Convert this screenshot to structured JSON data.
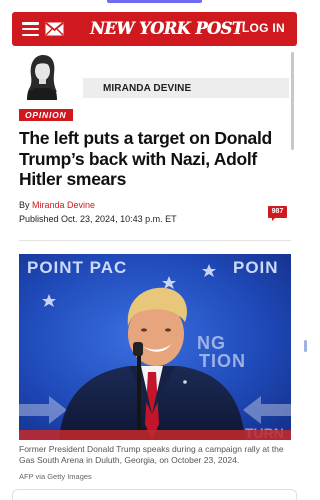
{
  "header": {
    "logo_text": "NEW YORK POST",
    "login_label": "LOG IN",
    "menu_icon": "hamburger-menu-icon",
    "mail_icon": "envelope-icon",
    "brand_color": "#d0181f"
  },
  "author": {
    "name": "MIRANDA DEVINE"
  },
  "article": {
    "tag": "OPINION",
    "headline": "The left puts a target on Donald Trump’s back with Nazi, Adolf Hitler smears",
    "byline_prefix": "By ",
    "byline_author": "Miranda Devine",
    "published": "Published Oct. 23, 2024, 10:43 p.m. ET",
    "comment_count": "987"
  },
  "photo": {
    "backdrop_text_left": "POINT PAC",
    "backdrop_text_right": "POIN",
    "backdrop_text_mid1": "NG",
    "backdrop_text_mid2": "TION",
    "backdrop_text_bottom": "TURN",
    "caption": "Former President Donald Trump speaks during a campaign rally at the Gas South Arena in Duluth, Georgia, on October 23, 2024.",
    "credit": "AFP via Getty Images"
  }
}
